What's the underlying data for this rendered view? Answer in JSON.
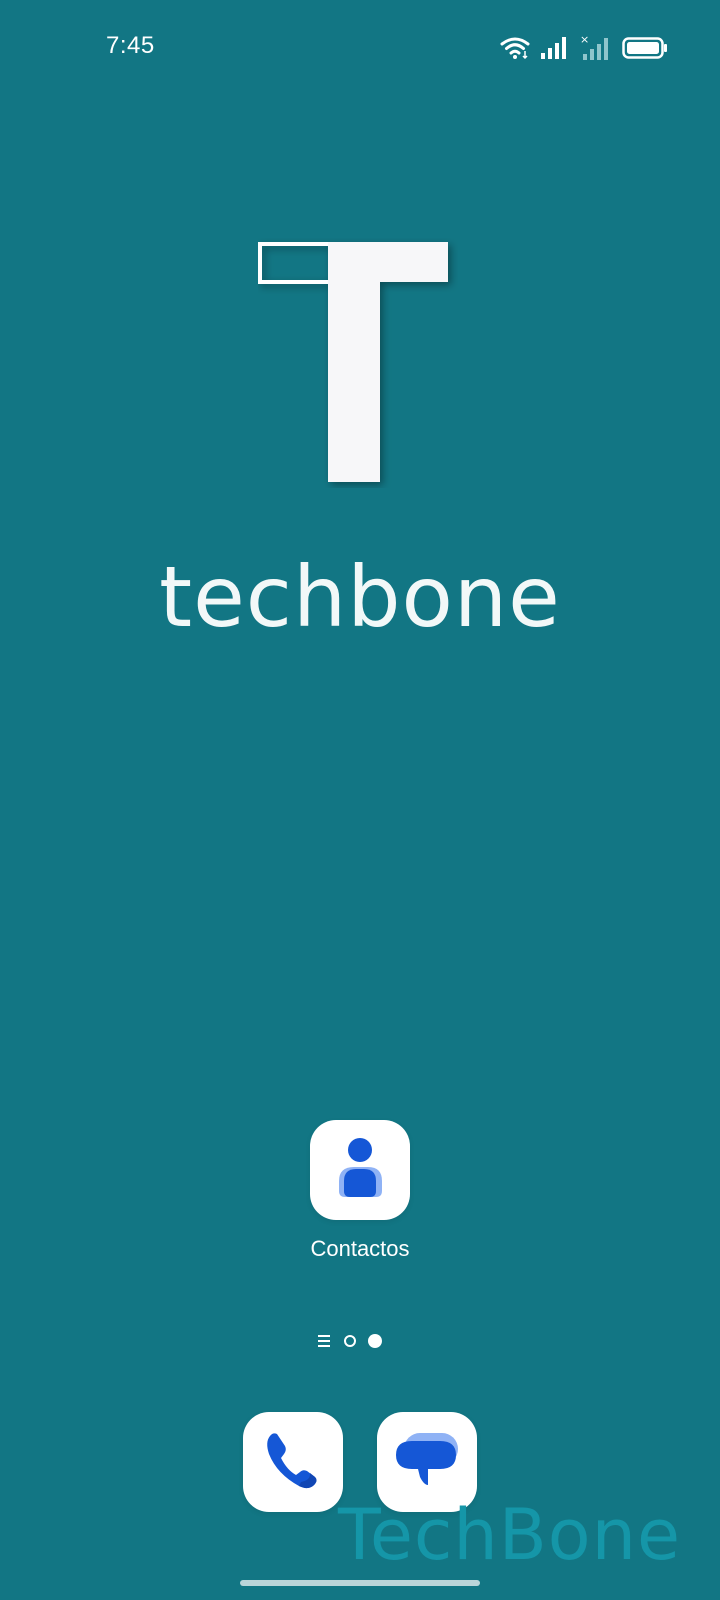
{
  "status_bar": {
    "time": "7:45",
    "icons": [
      "wifi-icon",
      "signal-icon",
      "signal-no-service-icon",
      "battery-icon"
    ]
  },
  "wallpaper": {
    "logo_letter": "T",
    "brand_text": "techbone",
    "background_color": "#127684"
  },
  "home": {
    "apps": [
      {
        "label": "Contactos",
        "icon": "contacts-icon"
      }
    ],
    "page_indicator": {
      "pages": 2,
      "current": 2,
      "has_list_view": true
    }
  },
  "dock": [
    {
      "label": "",
      "icon": "phone-icon"
    },
    {
      "label": "",
      "icon": "messages-icon"
    }
  ],
  "watermark": "TechBone"
}
